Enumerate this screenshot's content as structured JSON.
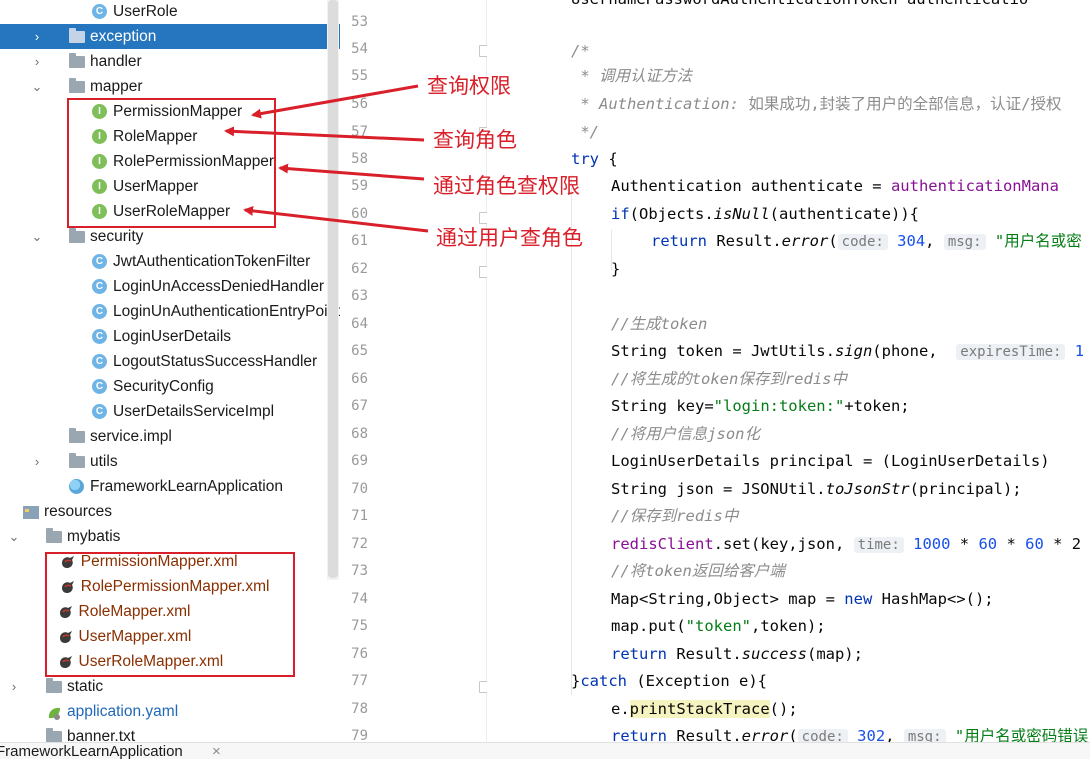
{
  "tree": {
    "items": [
      {
        "label": "UserRole",
        "icon": "class-icon"
      },
      {
        "label": "exception",
        "icon": "folder-icon",
        "selected": true
      },
      {
        "label": "handler",
        "icon": "folder-icon"
      },
      {
        "label": "mapper",
        "icon": "folder-icon"
      },
      {
        "label": "PermissionMapper",
        "icon": "interface-icon"
      },
      {
        "label": "RoleMapper",
        "icon": "interface-icon"
      },
      {
        "label": "RolePermissionMapper",
        "icon": "interface-icon"
      },
      {
        "label": "UserMapper",
        "icon": "interface-icon"
      },
      {
        "label": "UserRoleMapper",
        "icon": "interface-icon"
      },
      {
        "label": "security",
        "icon": "folder-icon"
      },
      {
        "label": "JwtAuthenticationTokenFilter",
        "icon": "class-icon"
      },
      {
        "label": "LoginUnAccessDeniedHandler",
        "icon": "class-icon"
      },
      {
        "label": "LoginUnAuthenticationEntryPoint",
        "icon": "class-icon"
      },
      {
        "label": "LoginUserDetails",
        "icon": "class-icon"
      },
      {
        "label": "LogoutStatusSuccessHandler",
        "icon": "class-icon"
      },
      {
        "label": "SecurityConfig",
        "icon": "class-icon"
      },
      {
        "label": "UserDetailsServiceImpl",
        "icon": "class-icon"
      },
      {
        "label": "service.impl",
        "icon": "folder-icon"
      },
      {
        "label": "utils",
        "icon": "folder-icon"
      },
      {
        "label": "FrameworkLearnApplication",
        "icon": "spring-app-icon"
      },
      {
        "label": "resources",
        "icon": "resources-folder-icon"
      },
      {
        "label": "mybatis",
        "icon": "folder-icon"
      },
      {
        "label": "PermissionMapper.xml",
        "icon": "mybatis-xml-icon"
      },
      {
        "label": "RolePermissionMapper.xml",
        "icon": "mybatis-xml-icon"
      },
      {
        "label": "RoleMapper.xml",
        "icon": "mybatis-xml-icon"
      },
      {
        "label": "UserMapper.xml",
        "icon": "mybatis-xml-icon"
      },
      {
        "label": "UserRoleMapper.xml",
        "icon": "mybatis-xml-icon"
      },
      {
        "label": "static",
        "icon": "folder-icon"
      },
      {
        "label": "application.yaml",
        "icon": "spring-yaml-icon"
      },
      {
        "label": "banner.txt",
        "icon": "text-file-icon"
      }
    ]
  },
  "annotations": {
    "query_permission": "查询权限",
    "query_role": "查询角色",
    "permission_by_role": "通过角色查权限",
    "role_by_user": "通过用户查角色",
    "color": "#d9202a"
  },
  "editor": {
    "line_numbers": [
      "53",
      "54",
      "55",
      "56",
      "57",
      "58",
      "59",
      "60",
      "61",
      "62",
      "63",
      "64",
      "65",
      "66",
      "67",
      "68",
      "69",
      "70",
      "71",
      "72",
      "73",
      "74",
      "75",
      "76",
      "77",
      "78",
      "79"
    ],
    "lines": {
      "l52": "UsernamePasswordAuthenticationToken authenticatio",
      "l54": "/*",
      "l55": " * 调用认证方法",
      "l56a": " * Authentication:",
      "l56b": " 如果成功,封装了用户的全部信息，认证/授权",
      "l57": " */",
      "l58a": "try",
      "l58b": " {",
      "l59a": "Authentication authenticate = ",
      "l59b": "authenticationMana",
      "l60a": "if",
      "l60b": "(Objects.",
      "l60c": "isNull",
      "l60d": "(authenticate)){",
      "l61a": "return",
      "l61b": " Result.",
      "l61c": "error",
      "l61d": "(",
      "l61e": "code:",
      "l61f": " 304",
      "l61g": ", ",
      "l61h": "msg:",
      "l61i": " \"用户名或密",
      "l62": "}",
      "l64": "//生成token",
      "l65a": "String token = JwtUtils.",
      "l65b": "sign",
      "l65c": "(phone,  ",
      "l65d": "expiresTime:",
      "l65e": " 1",
      "l66": "//将生成的token保存到redis中",
      "l67a": "String key=",
      "l67b": "\"login:token:\"",
      "l67c": "+token;",
      "l68": "//将用户信息json化",
      "l69": "LoginUserDetails principal = (LoginUserDetails) ",
      "l70a": "String json = JSONUtil.",
      "l70b": "toJsonStr",
      "l70c": "(principal);",
      "l71": "//保存到redis中",
      "l72a": "redisClient",
      "l72b": ".set(key,json, ",
      "l72c": "time:",
      "l72d": " 1000",
      "l72e": " * ",
      "l72f": "60",
      "l72g": " * ",
      "l72h": "60",
      "l72i": " * 2",
      "l73": "//将token返回给客户端",
      "l74a": "Map<String,Object> map = ",
      "l74b": "new",
      "l74c": " HashMap<>();",
      "l75a": "map.put(",
      "l75b": "\"token\"",
      "l75c": ",token);",
      "l76a": "return",
      "l76b": " Result.",
      "l76c": "success",
      "l76d": "(map);",
      "l77a": "}",
      "l77b": "catch",
      "l77c": " (Exception e){",
      "l78a": "e.",
      "l78b": "printStackTrace",
      "l78c": "();",
      "l79a": "return",
      "l79b": " Result.",
      "l79c": "error",
      "l79d": "(",
      "l79e": "code:",
      "l79f": " 302",
      "l79g": ", ",
      "l79h": "msg:",
      "l79i": " \"用户名或密码错误"
    }
  },
  "bottom_tab": {
    "label": "FrameworkLearnApplication",
    "close": "×"
  }
}
